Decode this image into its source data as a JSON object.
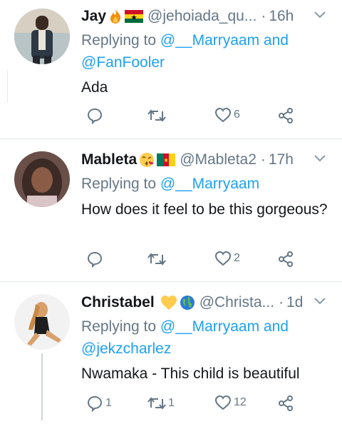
{
  "tweets": [
    {
      "name": "Jay",
      "emojis": [
        "fire-emoji",
        "ghana-flag-emoji"
      ],
      "handle": "@jehoiada_qu...",
      "dot": "·",
      "time": "16h",
      "reply_prefix": "Replying to",
      "reply_mentions": "@__Marryaam and @FanFooler",
      "text": "Ada",
      "reply_count": "",
      "retweet_count": "",
      "like_count": "6"
    },
    {
      "name": "Mableta",
      "emojis": [
        "kissing-face-emoji",
        "cameroon-flag-emoji"
      ],
      "handle": "@Mableta2",
      "dot": "·",
      "time": "17h",
      "reply_prefix": "Replying to",
      "reply_mentions": "@__Marryaam",
      "text": "How does it feel to be this gorgeous?",
      "reply_count": "",
      "retweet_count": "",
      "like_count": "2"
    },
    {
      "name": "Christabel",
      "emojis": [
        "yellow-heart-emoji",
        "globe-emoji"
      ],
      "handle": "@Christa...",
      "dot": "·",
      "time": "1d",
      "reply_prefix": "Replying to",
      "reply_mentions": "@__Marryaam and @jekzcharlez",
      "text": "Nwamaka - This child is beautiful",
      "reply_count": "1",
      "retweet_count": "1",
      "like_count": "12"
    }
  ],
  "colors": {
    "link": "#1da1f2",
    "secondary": "#657786",
    "divider": "#e1e8ed"
  }
}
